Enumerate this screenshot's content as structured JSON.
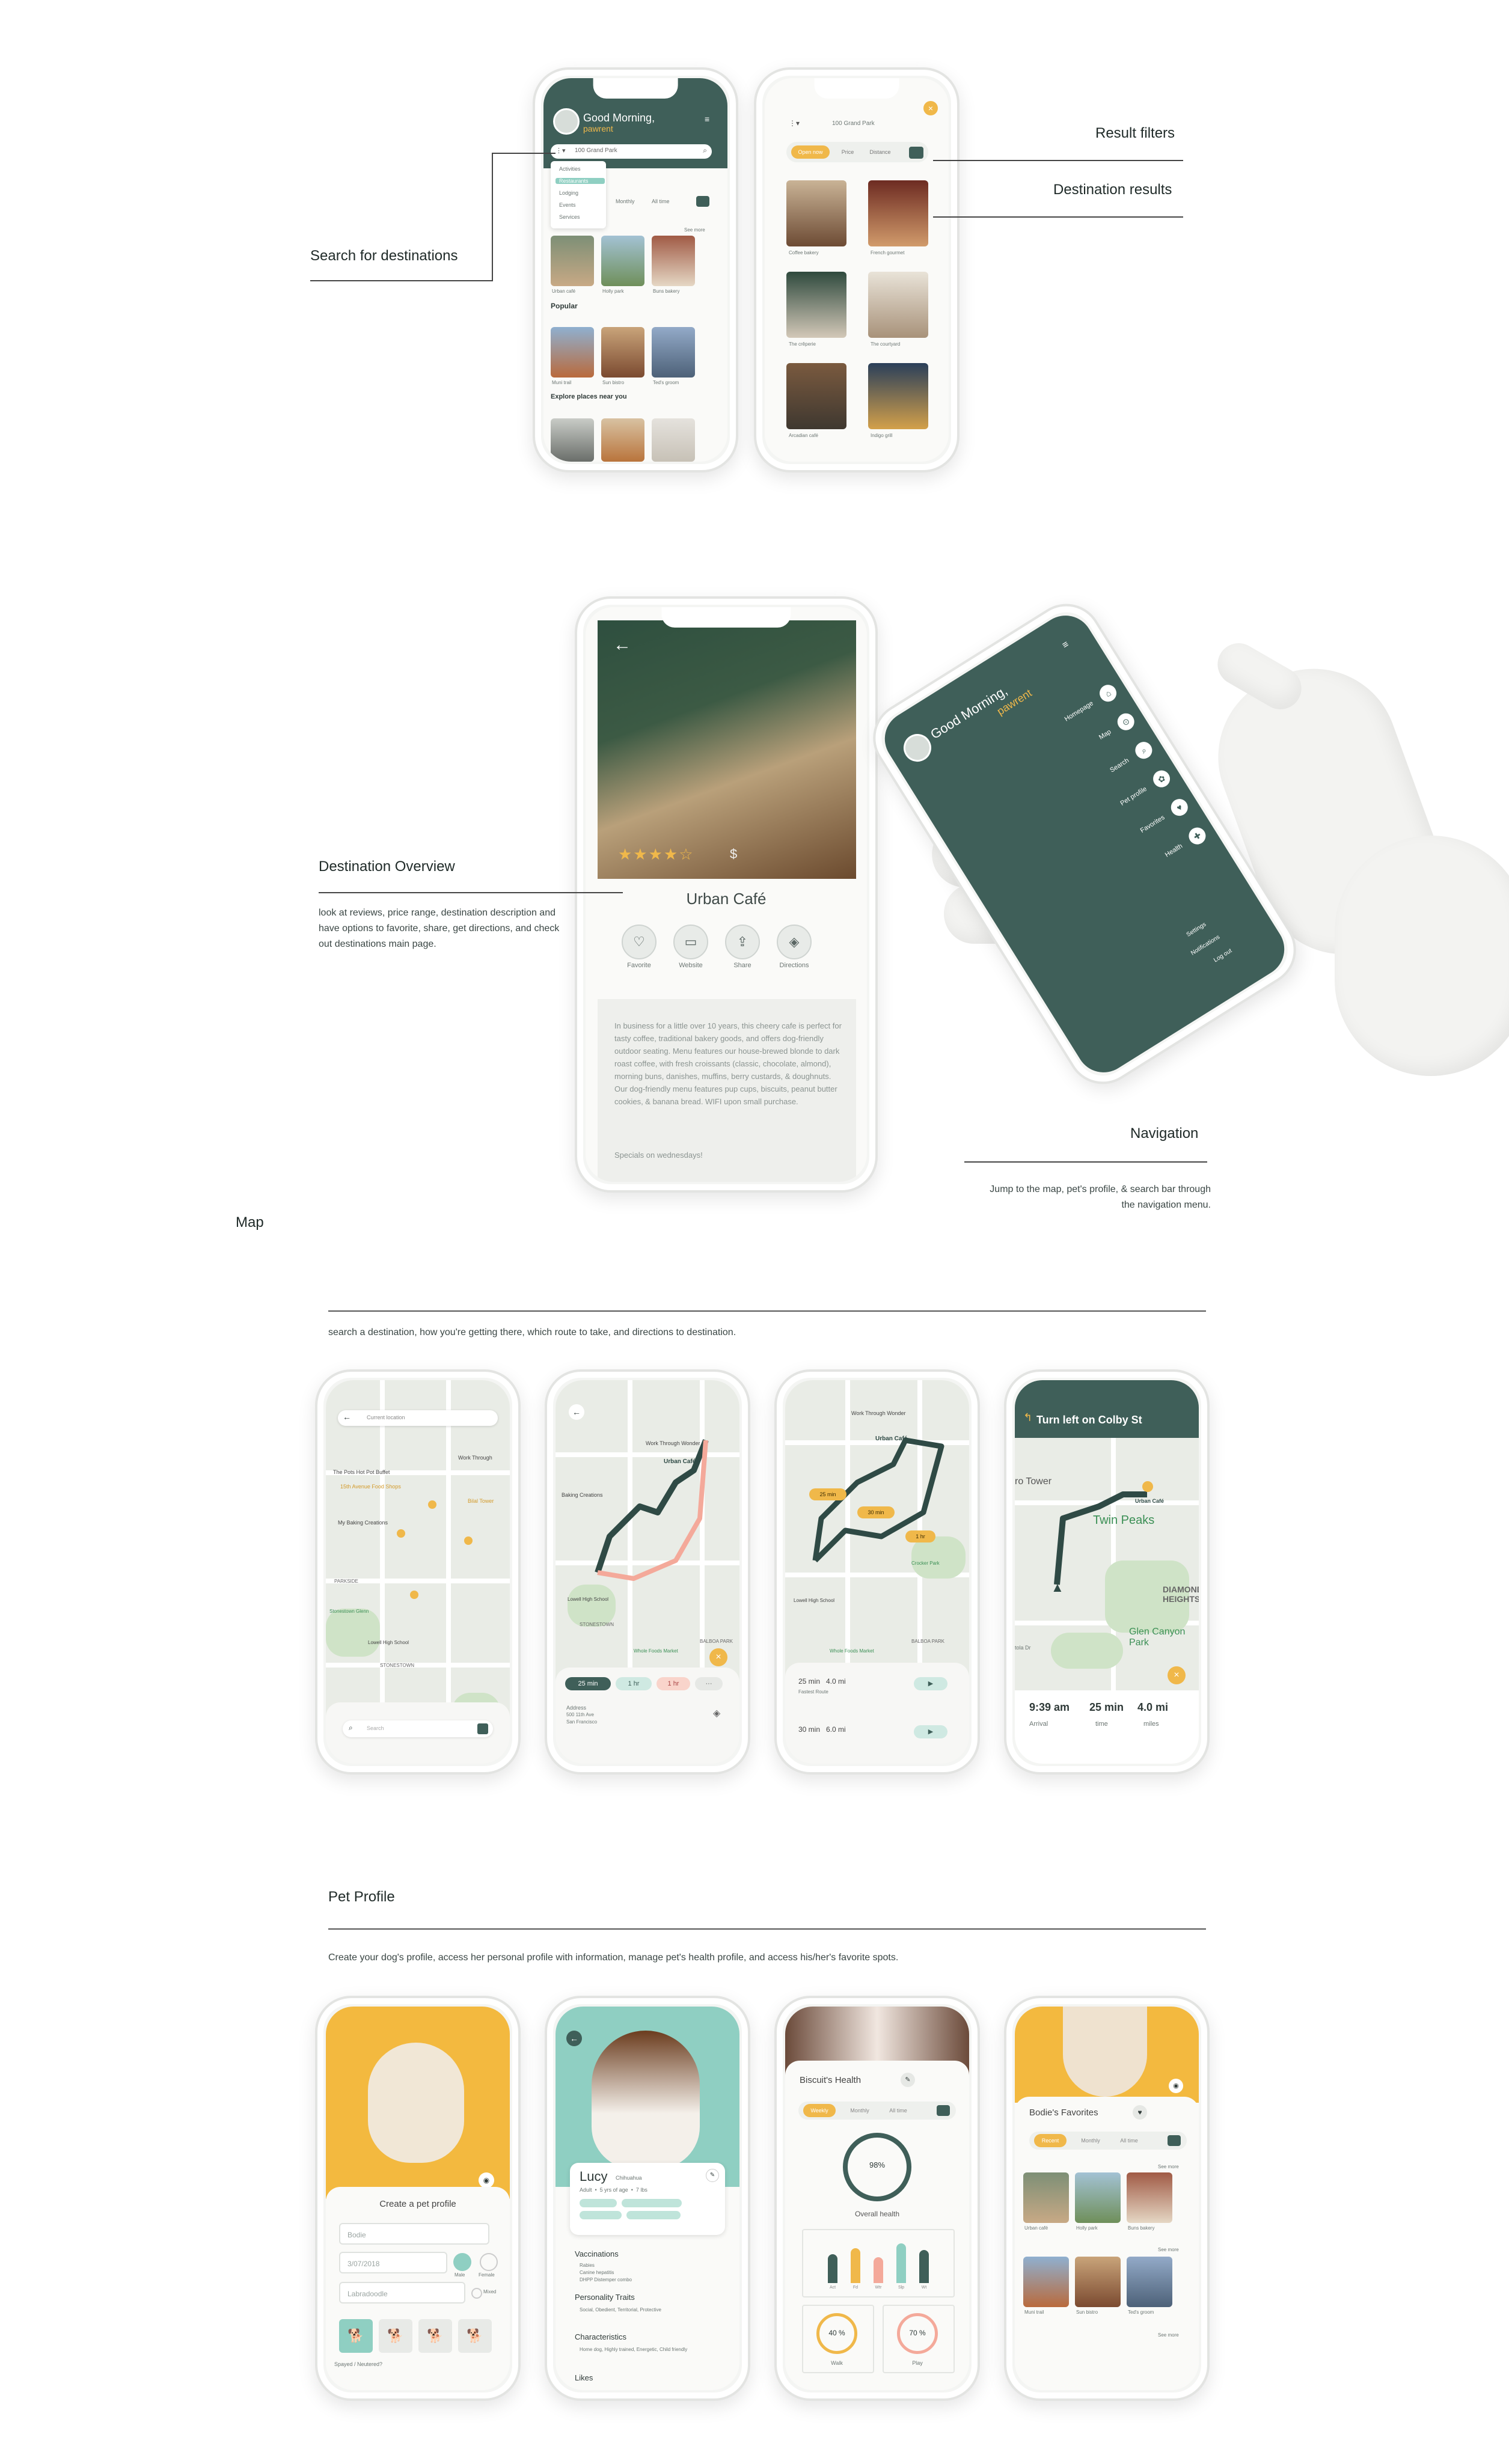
{
  "annotations": {
    "search_for_destinations": "Search for destinations",
    "result_filters": "Result filters",
    "destination_results": "Destination results",
    "destination_overview": "Destination Overview",
    "destination_overview_note": "look at reviews, price range, destination description and have options to favorite, share, get directions, and check out destinations main page.",
    "navigation": "Navigation",
    "navigation_note": "Jump to the map, pet's profile, & search bar through the navigation menu."
  },
  "map_section": {
    "title": "Map",
    "description": "search a destination, how you're getting there, which route to take, and directions to destination."
  },
  "pet_section": {
    "title": "Pet Profile",
    "description": "Create your dog's profile, access her personal profile with information, manage pet's health profile, and access his/her's favorite spots."
  },
  "home_screen": {
    "greeting": "Good Morning,",
    "username": "pawrent",
    "address": "100 Grand Park",
    "menu_items": [
      "Activities",
      "Restaurants",
      "Lodging",
      "Events",
      "Services"
    ],
    "tabs": [
      "Monthly",
      "All time"
    ],
    "see_more": "See more",
    "row1": [
      "Urban café",
      "Holly park",
      "Buns bakery"
    ],
    "popular_title": "Popular",
    "row2": [
      "Muni trail",
      "Sun bistro",
      "Ted's groom"
    ],
    "explore_title": "Explore places near you"
  },
  "results_screen": {
    "address": "100 Grand Park",
    "filters": [
      "Open now",
      "Price",
      "Distance"
    ],
    "results": [
      "Coffee bakery",
      "French gourmet",
      "The crêperie",
      "The courtyard",
      "Arcadian café",
      "Indigo grill"
    ]
  },
  "overview_screen": {
    "name": "Urban Café",
    "price": "$",
    "actions": [
      "Favorite",
      "Website",
      "Share",
      "Directions"
    ],
    "description": "In business for a little over 10 years, this cheery cafe is perfect for tasty coffee, traditional bakery goods, and offers dog-friendly outdoor seating. Menu features our house-brewed blonde to dark roast coffee, with fresh croissants (classic, chocolate, almond), morning buns, danishes, muffins, berry custards, & doughnuts. Our dog-friendly menu features pup cups, biscuits, peanut butter cookies, & banana bread. WIFI upon small purchase.",
    "specials": "Specials on wednesdays!"
  },
  "nav_screen": {
    "greeting": "Good Morning,",
    "username": "pawrent",
    "items": [
      "Homepage",
      "Map",
      "Search",
      "Pet profile",
      "Favorites",
      "Health"
    ],
    "footer": [
      "Settings",
      "Notifications",
      "Log out"
    ]
  },
  "map1": {
    "current_location": "Current location",
    "places": [
      "The Pots Hot Pot Buffet",
      "Work Through",
      "15th Avenue Food Shops",
      "Bilal Tower",
      "My Baking Creations",
      "PARKSIDE",
      "Stonestown Glenn",
      "Lowell High School",
      "STONESTOWN"
    ],
    "search_placeholder": "Search"
  },
  "map2": {
    "places": [
      "Work Through Wonder",
      "Urban Café",
      "Baking Creations",
      "STONESTOWN",
      "Lowell High School",
      "Whole Foods Market",
      "BALBOA PARK"
    ],
    "modes": [
      "25 min",
      "1 hr",
      "1 hr"
    ],
    "address_label": "Address",
    "address_line1": "500 11th Ave",
    "address_line2": "San Francisco"
  },
  "map3": {
    "places": [
      "Work Through Wonder",
      "Urban Café",
      "Lowell High School",
      "Whole Foods Market",
      "BALBOA PARK",
      "Crocker Park"
    ],
    "times": [
      "25 min",
      "30 min",
      "1 hr"
    ],
    "route1": "25 min   4.0 mi",
    "route1_note": "Fastest Route",
    "route2": "30 min   6.0 mi"
  },
  "map4": {
    "direction": "Turn left on Colby St",
    "places": [
      "ro Tower",
      "Urban Café",
      "Twin Peaks",
      "DIAMOND HEIGHTS",
      "Glen Canyon Park",
      "tola Dr"
    ],
    "arrival": "9:39 am",
    "time": "25 min",
    "miles": "4.0 mi",
    "arrival_label": "Arrival",
    "time_label": "time",
    "miles_label": "miles"
  },
  "create_profile": {
    "title": "Create a pet profile",
    "name_field": "Bodie",
    "date_field": "3/07/2018",
    "breed_field": "Labradoodle",
    "gender": [
      "Male",
      "Female"
    ],
    "mixed": "Mixed",
    "spayed": "Spayed / Neutered?"
  },
  "lucy_profile": {
    "name": "Lucy",
    "breed": "Chihuahua",
    "details": "Adult  •  5 yrs of age  •  7 lbs",
    "vaccinations_title": "Vaccinations",
    "vaccinations": [
      "Rabies",
      "Canine hepatitis",
      "DHPP Distemper combo"
    ],
    "personality_title": "Personality Traits",
    "personality": "Social, Obedient, Territorial, Protective",
    "characteristics_title": "Characteristics",
    "characteristics": "Home dog, Highly trained, Energetic, Child friendly",
    "likes_title": "Likes"
  },
  "health": {
    "title": "Biscuit's Health",
    "tabs": [
      "Weekly",
      "Monthly",
      "All time"
    ],
    "overall_value": "98%",
    "overall_label": "Overall health",
    "bar_labels": [
      "Act",
      "Fd",
      "Wtr",
      "Slp",
      "Wt"
    ],
    "bar_values": [
      0.62,
      0.75,
      0.55,
      0.85,
      0.7
    ],
    "bar_colors": [
      "#3f5f59",
      "#f0b84a",
      "#f4a99a",
      "#8fcfc2",
      "#3f5f59"
    ],
    "stat1": "40 %",
    "stat2": "70 %",
    "stat1_label": "Walk",
    "stat2_label": "Play"
  },
  "favorites": {
    "title": "Bodie's Favorites",
    "tabs": [
      "Recent",
      "Monthly",
      "All time"
    ],
    "see_more": "See more",
    "row1": [
      "Urban café",
      "Holly park",
      "Buns bakery"
    ],
    "row2": [
      "Muni trail",
      "Sun bistro",
      "Ted's groom"
    ]
  },
  "colors": {
    "brand_green": "#3f5f59",
    "accent_yellow": "#f0b84a",
    "mint": "#8fcfc2",
    "coral": "#f4a99a"
  }
}
